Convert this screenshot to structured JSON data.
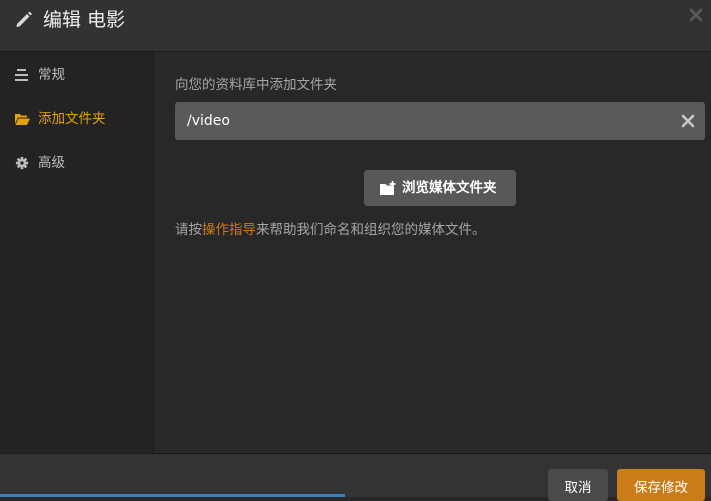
{
  "header": {
    "title": "编辑 电影",
    "edit_icon": "pencil-icon",
    "close_icon": "close-icon"
  },
  "sidebar": {
    "items": [
      {
        "label": "常规",
        "icon": "sliders-icon",
        "active": false
      },
      {
        "label": "添加文件夹",
        "icon": "folder-open-icon",
        "active": true
      },
      {
        "label": "高级",
        "icon": "gear-icon",
        "active": false
      }
    ]
  },
  "main": {
    "prompt": "向您的资料库中添加文件夹",
    "folder_path": "/video",
    "clear_icon": "clear-icon",
    "browse_button": {
      "label": "浏览媒体文件夹",
      "icon": "folder-plus-icon"
    },
    "help": {
      "before": "请按",
      "link": "操作指导",
      "after": "来帮助我们命名和组织您的媒体文件。"
    }
  },
  "footer": {
    "cancel_label": "取消",
    "save_label": "保存修改"
  },
  "colors": {
    "accent": "#cc7b19",
    "active_nav": "#e5a00d",
    "background": "#282828",
    "sidebar": "#232323"
  }
}
